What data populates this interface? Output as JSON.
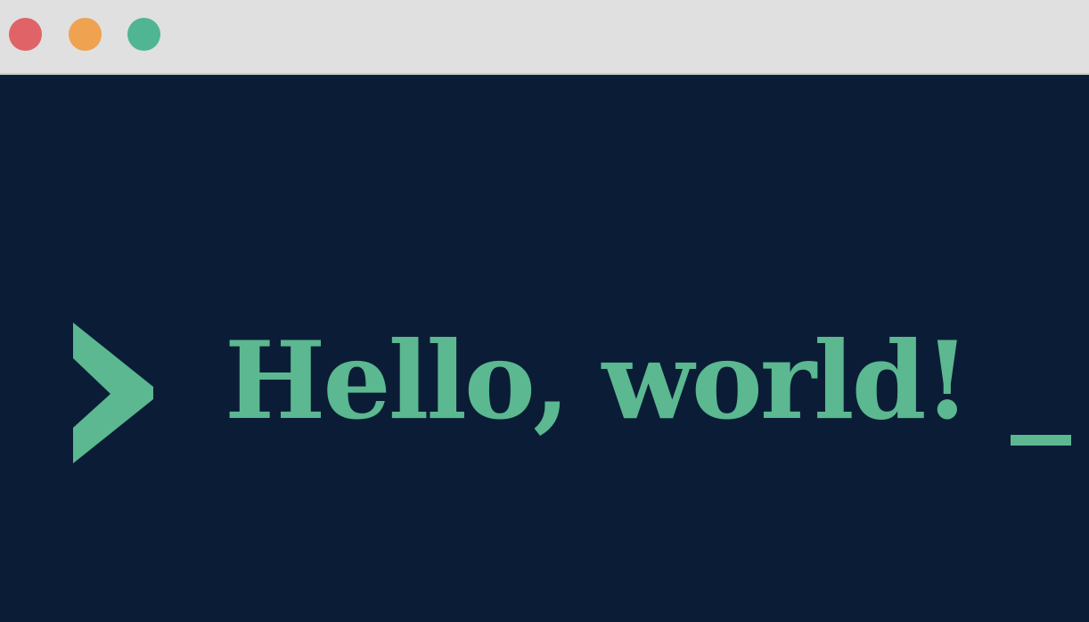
{
  "window": {
    "traffic_lights": [
      {
        "name": "close",
        "color": "#df6367"
      },
      {
        "name": "minimize",
        "color": "#efa24f"
      },
      {
        "name": "maximize",
        "color": "#4fb592"
      }
    ]
  },
  "terminal": {
    "background": "#0b1d36",
    "accent_color": "#5bb890",
    "prompt_icon": "chevron-right-icon",
    "text": "Hello, world!",
    "cursor": "_"
  }
}
